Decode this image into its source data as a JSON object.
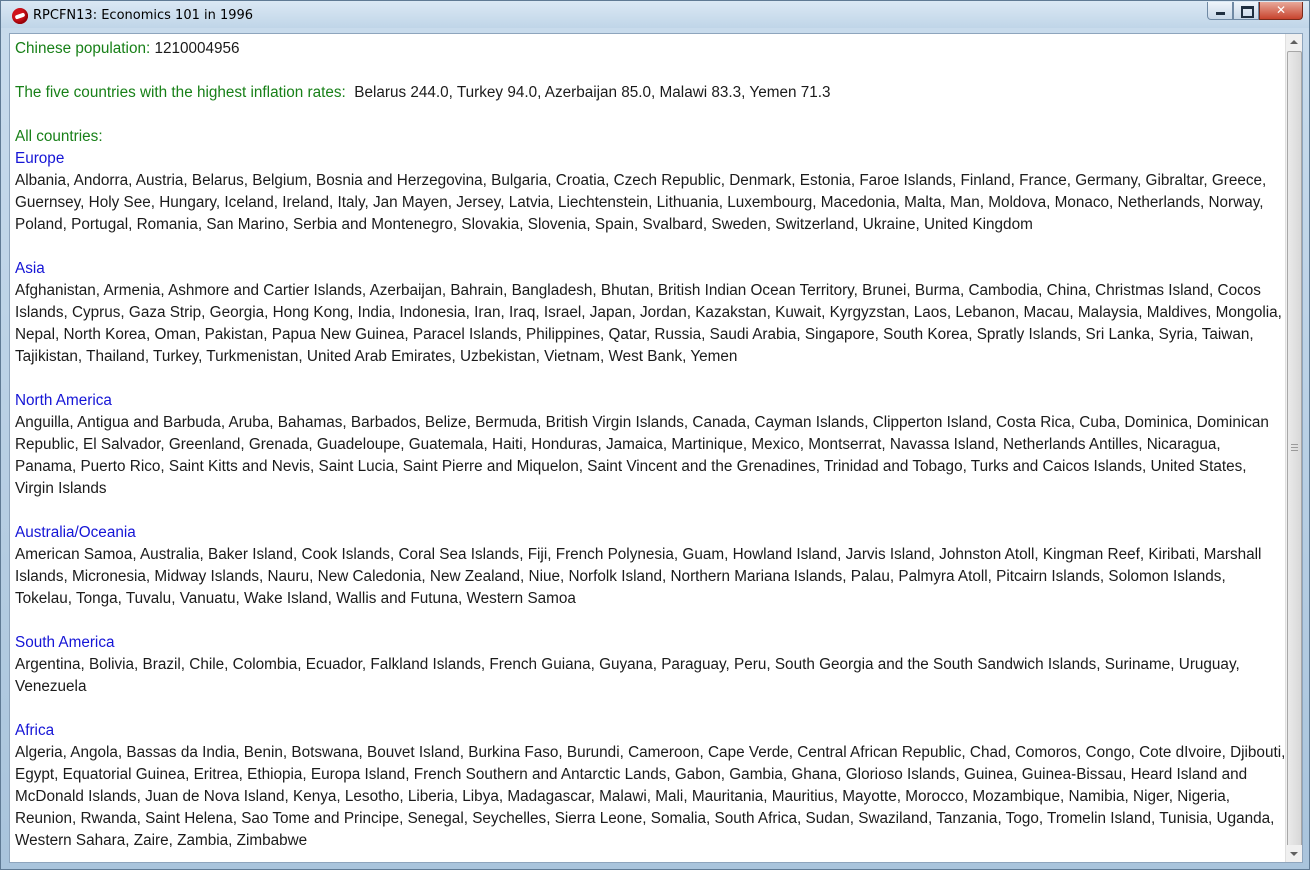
{
  "window": {
    "title": "RPCFN13: Economics 101 in 1996",
    "controls": {
      "minimize": "—",
      "maximize": "",
      "close": "✕"
    },
    "icon": "ruby-app-icon"
  },
  "population": {
    "label": "Chinese population:",
    "value": "1210004956"
  },
  "inflation": {
    "label": "The five countries with the highest inflation rates:",
    "value": "Belarus 244.0, Turkey 94.0, Azerbaijan 85.0, Malawi 83.3, Yemen 71.3"
  },
  "all_countries": {
    "label": "All countries:",
    "regions": [
      {
        "name": "Europe",
        "countries": "Albania, Andorra, Austria, Belarus, Belgium, Bosnia and Herzegovina, Bulgaria, Croatia, Czech Republic, Denmark, Estonia, Faroe Islands, Finland, France, Germany, Gibraltar, Greece, Guernsey, Holy See, Hungary, Iceland, Ireland, Italy, Jan Mayen, Jersey, Latvia, Liechtenstein, Lithuania, Luxembourg, Macedonia, Malta, Man, Moldova, Monaco, Netherlands, Norway, Poland, Portugal, Romania, San Marino, Serbia and Montenegro, Slovakia, Slovenia, Spain, Svalbard, Sweden, Switzerland, Ukraine, United Kingdom"
      },
      {
        "name": "Asia",
        "countries": "Afghanistan, Armenia, Ashmore and Cartier Islands, Azerbaijan, Bahrain, Bangladesh, Bhutan, British Indian Ocean Territory, Brunei, Burma, Cambodia, China, Christmas Island, Cocos Islands, Cyprus, Gaza Strip, Georgia, Hong Kong, India, Indonesia, Iran, Iraq, Israel, Japan, Jordan, Kazakstan, Kuwait, Kyrgyzstan, Laos, Lebanon, Macau, Malaysia, Maldives, Mongolia, Nepal, North Korea, Oman, Pakistan, Papua New Guinea, Paracel Islands, Philippines, Qatar, Russia, Saudi Arabia, Singapore, South Korea, Spratly Islands, Sri Lanka, Syria, Taiwan, Tajikistan, Thailand, Turkey, Turkmenistan, United Arab Emirates, Uzbekistan, Vietnam, West Bank, Yemen"
      },
      {
        "name": "North America",
        "countries": "Anguilla, Antigua and Barbuda, Aruba, Bahamas, Barbados, Belize, Bermuda, British Virgin Islands, Canada, Cayman Islands, Clipperton Island, Costa Rica, Cuba, Dominica, Dominican Republic, El Salvador, Greenland, Grenada, Guadeloupe, Guatemala, Haiti, Honduras, Jamaica, Martinique, Mexico, Montserrat, Navassa Island, Netherlands Antilles, Nicaragua, Panama, Puerto Rico, Saint Kitts and Nevis, Saint Lucia, Saint Pierre and Miquelon, Saint Vincent and the Grenadines, Trinidad and Tobago, Turks and Caicos Islands, United States, Virgin Islands"
      },
      {
        "name": "Australia/Oceania",
        "countries": "American Samoa, Australia, Baker Island, Cook Islands, Coral Sea Islands, Fiji, French Polynesia, Guam, Howland Island, Jarvis Island, Johnston Atoll, Kingman Reef, Kiribati, Marshall Islands, Micronesia, Midway Islands, Nauru, New Caledonia, New Zealand, Niue, Norfolk Island, Northern Mariana Islands, Palau, Palmyra Atoll, Pitcairn Islands, Solomon Islands, Tokelau, Tonga, Tuvalu, Vanuatu, Wake Island, Wallis and Futuna, Western Samoa"
      },
      {
        "name": "South America",
        "countries": "Argentina, Bolivia, Brazil, Chile, Colombia, Ecuador, Falkland Islands, French Guiana, Guyana, Paraguay, Peru, South Georgia and the South Sandwich Islands, Suriname, Uruguay, Venezuela"
      },
      {
        "name": "Africa",
        "countries": "Algeria, Angola, Bassas da India, Benin, Botswana, Bouvet Island, Burkina Faso, Burundi, Cameroon, Cape Verde, Central African Republic, Chad, Comoros, Congo, Cote dIvoire, Djibouti, Egypt, Equatorial Guinea, Eritrea, Ethiopia, Europa Island, French Southern and Antarctic Lands, Gabon, Gambia, Ghana, Glorioso Islands, Guinea, Guinea-Bissau, Heard Island and McDonald Islands, Juan de Nova Island, Kenya, Lesotho, Liberia, Libya, Madagascar, Malawi, Mali, Mauritania, Mauritius, Mayotte, Morocco, Mozambique, Namibia, Niger, Nigeria, Reunion, Rwanda, Saint Helena, Sao Tome and Principe, Senegal, Seychelles, Sierra Leone, Somalia, South Africa, Sudan, Swaziland, Tanzania, Togo, Tromelin Island, Tunisia, Uganda, Western Sahara, Zaire, Zambia, Zimbabwe"
      }
    ]
  },
  "colors": {
    "label_green": "#188018",
    "region_blue": "#1515d6",
    "text": "#1b1b1b"
  }
}
